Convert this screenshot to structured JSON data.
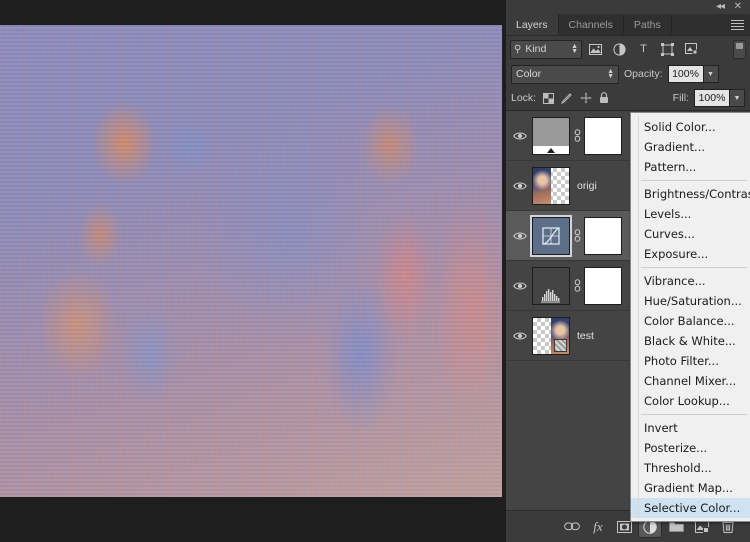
{
  "window": {
    "collapse_icon": "collapse-panel-icon",
    "close_icon": "close-panel-icon",
    "collapse_glyph": "◂◂",
    "close_glyph": "✕"
  },
  "panel": {
    "tabs": [
      {
        "label": "Layers",
        "active": true
      },
      {
        "label": "Channels",
        "active": false
      },
      {
        "label": "Paths",
        "active": false
      }
    ],
    "menu_button": "panel-options-menu"
  },
  "filter_row": {
    "kind_label": "Kind",
    "search_icon": "search-icon",
    "filters": [
      {
        "name": "filter-pixel-layers-icon",
        "title": "Pixel Layers"
      },
      {
        "name": "filter-adjustment-layers-icon",
        "title": "Adjustment Layers"
      },
      {
        "name": "filter-type-layers-icon",
        "title": "Type Layers",
        "glyph": "T"
      },
      {
        "name": "filter-shape-layers-icon",
        "title": "Shape Layers"
      },
      {
        "name": "filter-smart-object-icon",
        "title": "Smart Objects"
      }
    ],
    "toggle_name": "filter-enable-toggle"
  },
  "blend_row": {
    "blend_mode": "Color",
    "opacity_label": "Opacity:",
    "opacity_value": "100%"
  },
  "lock_row": {
    "lock_label": "Lock:",
    "lock_icons": [
      {
        "name": "lock-transparent-pixels-icon",
        "glyph": "▨"
      },
      {
        "name": "lock-image-pixels-icon",
        "glyph": "✎"
      },
      {
        "name": "lock-position-icon",
        "glyph": "✥"
      },
      {
        "name": "lock-all-icon",
        "glyph": "🔒"
      }
    ],
    "fill_label": "Fill:",
    "fill_value": "100%"
  },
  "layers": [
    {
      "name": "",
      "visible": true,
      "selected": false,
      "thumb_type": "gradient-map",
      "has_link": true,
      "has_mask": true
    },
    {
      "name": "origi",
      "visible": true,
      "selected": false,
      "thumb_type": "photo-transparent",
      "has_link": false,
      "has_mask": false
    },
    {
      "name": "",
      "visible": true,
      "selected": true,
      "thumb_type": "curves",
      "has_link": true,
      "has_mask": true
    },
    {
      "name": "",
      "visible": true,
      "selected": false,
      "thumb_type": "levels",
      "has_link": true,
      "has_mask": true
    },
    {
      "name": "test",
      "visible": true,
      "selected": false,
      "thumb_type": "photo-checker",
      "has_link": false,
      "has_mask": false
    }
  ],
  "panel_bottom": {
    "buttons": [
      {
        "name": "link-layers-button",
        "title": "Link layers",
        "active": false
      },
      {
        "name": "layer-style-button",
        "title": "Add a layer style",
        "active": false,
        "glyph": "fx"
      },
      {
        "name": "add-layer-mask-button",
        "title": "Add layer mask",
        "active": false
      },
      {
        "name": "new-adjustment-layer-button",
        "title": "Create new fill or adjustment layer",
        "active": true
      },
      {
        "name": "new-group-button",
        "title": "Create a new group",
        "active": false
      },
      {
        "name": "new-layer-button",
        "title": "Create a new layer",
        "active": false
      },
      {
        "name": "delete-layer-button",
        "title": "Delete layer",
        "active": false
      }
    ]
  },
  "adjustment_menu": {
    "highlighted": "Selective Color...",
    "groups": [
      [
        "Solid Color...",
        "Gradient...",
        "Pattern..."
      ],
      [
        "Brightness/Contrast...",
        "Levels...",
        "Curves...",
        "Exposure..."
      ],
      [
        "Vibrance...",
        "Hue/Saturation...",
        "Color Balance...",
        "Black & White...",
        "Photo Filter...",
        "Channel Mixer...",
        "Color Lookup..."
      ],
      [
        "Invert",
        "Posterize...",
        "Threshold...",
        "Gradient Map...",
        "Selective Color..."
      ]
    ]
  },
  "colors": {
    "panel_bg": "#3b3b3b",
    "list_bg": "#444444",
    "selected_row": "#5a5a5a",
    "menu_bg": "#f0f0f0",
    "menu_highlight": "#cfe2f2",
    "app_bg": "#1e1e1e"
  }
}
